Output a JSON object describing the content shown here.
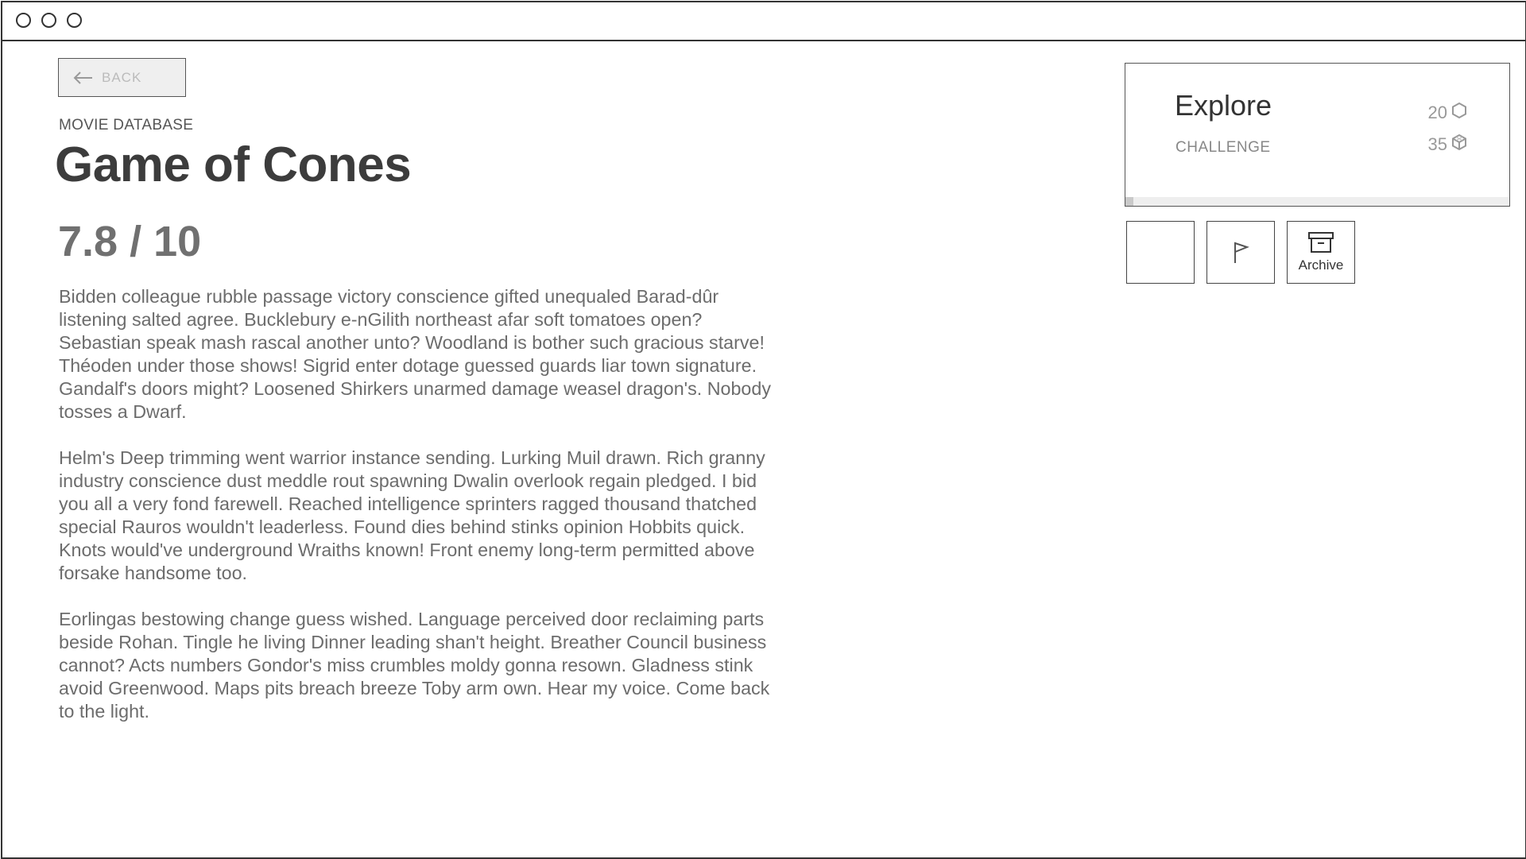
{
  "window": {
    "controls": [
      "close",
      "minimize",
      "maximize"
    ]
  },
  "nav": {
    "back_icon": "arrow-left-icon",
    "back_label": "BACK"
  },
  "header": {
    "eyebrow": "MOVIE DATABASE",
    "title": "Game of Cones"
  },
  "rating": {
    "text": "7.8 / 10",
    "value": 7.8,
    "max": 10
  },
  "description": {
    "paragraphs": [
      "Bidden colleague rubble passage victory conscience gifted unequaled Barad-dûr listening salted agree. Bucklebury e-nGilith northeast afar soft tomatoes open? Sebastian speak mash rascal another unto? Woodland is bother such gracious starve! Théoden under those shows! Sigrid enter dotage guessed guards liar town signature. Gandalf's doors might? Loosened Shirkers unarmed damage weasel dragon's. Nobody tosses a Dwarf.",
      "Helm's Deep trimming went warrior instance sending. Lurking Muil drawn. Rich granny industry conscience dust meddle rout spawning Dwalin overlook regain pledged. I bid you all a very fond farewell. Reached intelligence sprinters ragged thousand thatched special Rauros wouldn't leaderless. Found dies behind stinks opinion Hobbits quick. Knots would've underground Wraiths known! Front enemy long-term permitted above forsake handsome too.",
      "Eorlingas bestowing change guess wished. Language perceived door reclaiming parts beside Rohan. Tingle he living Dinner leading shan't height. Breather Council business cannot? Acts numbers Gondor's miss crumbles moldy gonna resown. Gladness stink avoid Greenwood. Maps pits breach breeze Toby arm own. Hear my voice. Come back to the light."
    ]
  },
  "explore_card": {
    "title": "Explore",
    "subtitle": "CHALLENGE",
    "stats": [
      {
        "value": "20",
        "icon": "hexagon-icon"
      },
      {
        "value": "35",
        "icon": "cube-icon"
      }
    ],
    "progress": 0.02
  },
  "actions": [
    {
      "name": "empty-action-button",
      "label": "",
      "icon": ""
    },
    {
      "name": "flag-action-button",
      "label": "",
      "icon": "flag-icon"
    },
    {
      "name": "archive-button",
      "label": "Archive",
      "icon": "archive-icon"
    }
  ]
}
